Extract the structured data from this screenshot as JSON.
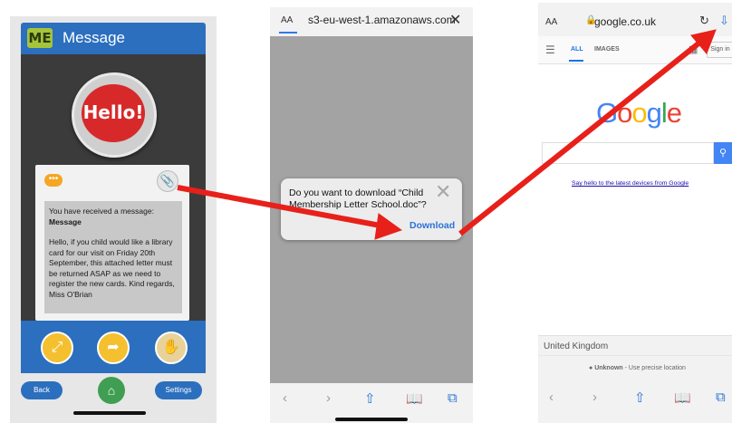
{
  "panel1": {
    "logo_text": "ME",
    "header_title": "Message",
    "hello_text": "Hello!",
    "chat_icon": "speech-bubble-icon",
    "attachment_icon": "paperclip-icon",
    "message_intro": "You have received a message:",
    "message_title": "Message",
    "message_body": "Hello, if you child would like a library card for our visit on Friday 20th September, this attached letter must be returned ASAP as we need to register the new cards. Kind regards, Miss O'Brian",
    "footer_icons": [
      "expand-icon",
      "share-icon",
      "hand-icon"
    ],
    "back_label": "Back",
    "settings_label": "Settings",
    "home_icon": "home-icon",
    "colors": {
      "header": "#2b6fbe",
      "accent": "#f4c030",
      "hello": "#d8292a"
    }
  },
  "panel2": {
    "aa_label": "AA",
    "url": "s3-eu-west-1.amazonaws.com",
    "close_icon": "close-icon",
    "dialog_text": "Do you want to download “Child Membership Letter School.doc”?",
    "dialog_close_icon": "close-icon",
    "download_label": "Download",
    "toolbar_icons": [
      "back-icon",
      "forward-icon",
      "share-icon",
      "bookmarks-icon",
      "tabs-icon"
    ]
  },
  "panel3": {
    "aa_label": "AA",
    "url": "google.co.uk",
    "lock_icon": "lock-icon",
    "reload_icon": "reload-icon",
    "downloads_icon": "downloads-icon",
    "tab_all": "ALL",
    "tab_images": "IMAGES",
    "signin_label": "Sign in",
    "google_logo": "Google",
    "promo_text": "Say hello to the latest devices from Google",
    "country": "United Kingdom",
    "location_bold": "Unknown",
    "location_rest": " - Use precise location",
    "toolbar_icons": [
      "back-icon",
      "forward-icon",
      "share-icon",
      "bookmarks-icon",
      "tabs-icon"
    ],
    "colors": {
      "blue": "#4285f4",
      "red": "#ea4335",
      "yellow": "#fbbc05",
      "green": "#34a853"
    }
  },
  "arrows": {
    "color": "#e8201a"
  }
}
